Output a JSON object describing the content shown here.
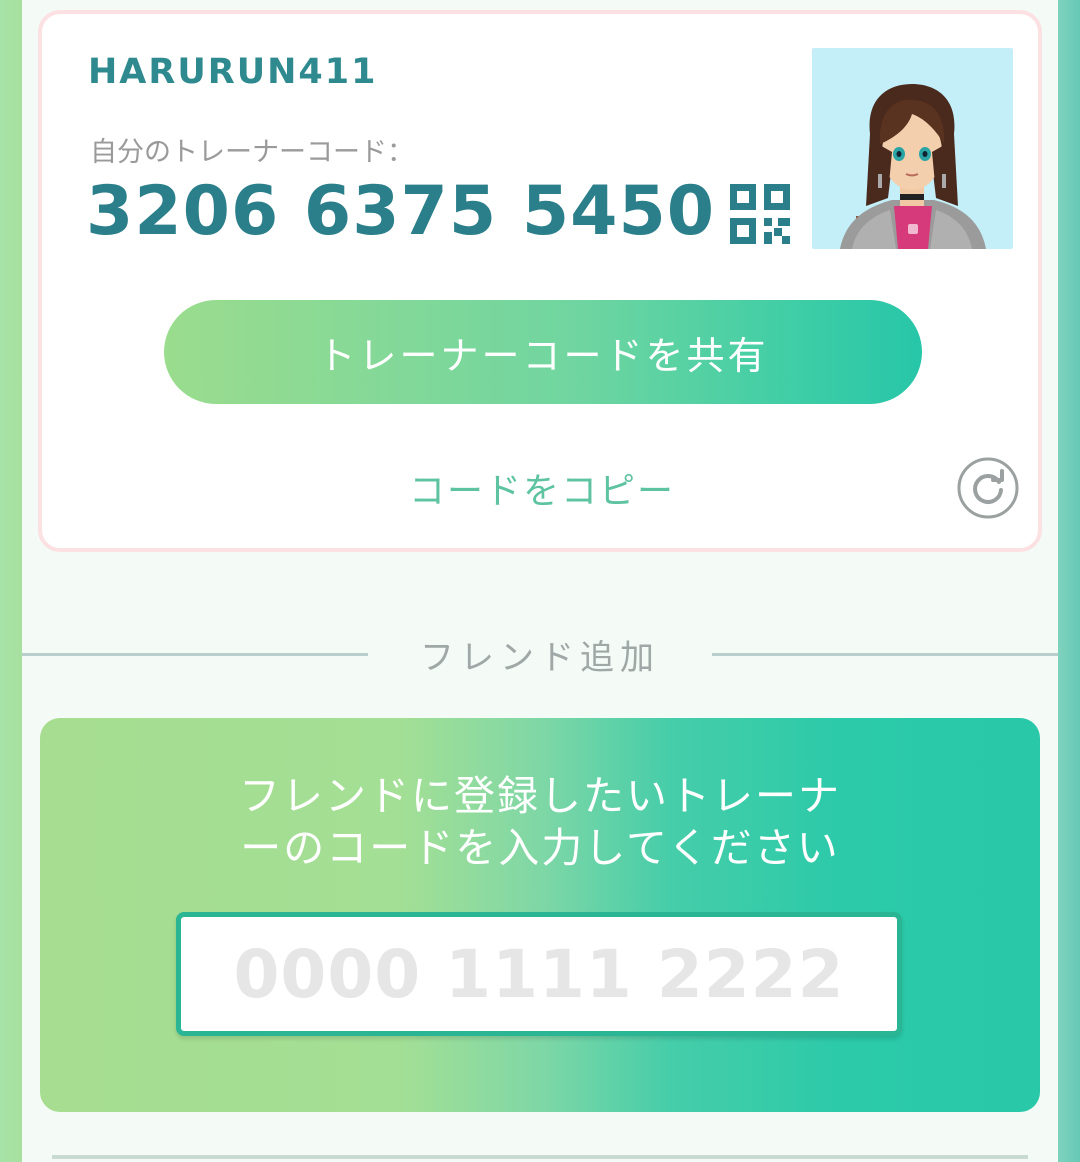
{
  "trainer": {
    "username": "HARURUN411",
    "code_label": "自分のトレーナーコード：",
    "code": "3206 6375 5450",
    "qr_icon": "qr-code-icon",
    "avatar_icon": "trainer-avatar"
  },
  "actions": {
    "share_label": "トレーナーコードを共有",
    "copy_label": "コードをコピー",
    "refresh_icon": "refresh-icon"
  },
  "add_friend": {
    "section_title": "フレンド追加",
    "prompt_line1": "フレンドに登録したいトレーナ",
    "prompt_line2": "ーのコードを入力してください",
    "input_placeholder": "0000 1111 2222",
    "input_value": ""
  },
  "colors": {
    "accent_teal": "#2b7f8a",
    "brand_green": "#28c8a9",
    "copy_text": "#5ec3a0"
  }
}
